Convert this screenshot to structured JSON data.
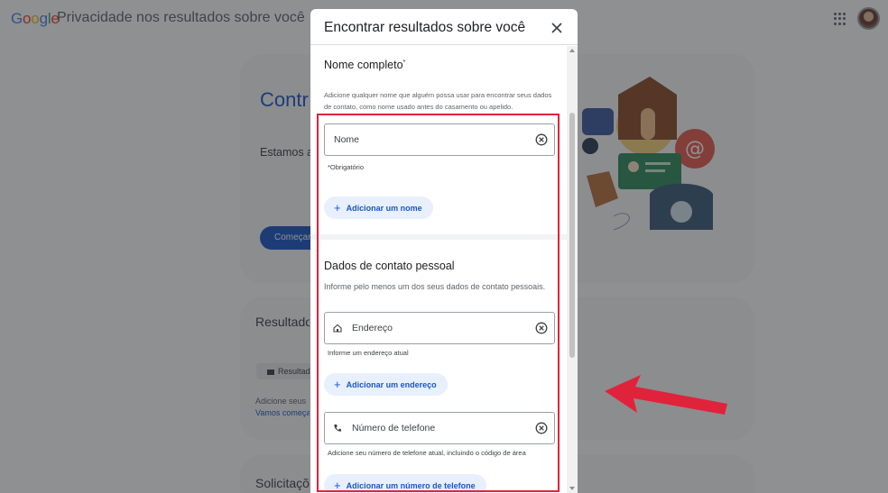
{
  "header": {
    "logo_text": "Google",
    "app_title": "Privacidade nos resultados sobre você"
  },
  "background": {
    "hero_title": "Contr privac",
    "hero_text": "Estamos ac suas inform no Google qualquer r desconfor",
    "hero_button": "Começar",
    "results_title": "Resultados",
    "results_chip": "Resultad",
    "results_text": "Adicione seus",
    "results_link": "Vamos começa",
    "requests_title": "Solicitações"
  },
  "modal": {
    "title": "Encontrar resultados sobre você",
    "name_section": {
      "title": "Nome completo",
      "required_mark": "*",
      "description": "Adicione qualquer nome que alguém possa usar para encontrar seus dados de contato, como nome usado antes do casamento ou apelido.",
      "field_placeholder": "Nome",
      "helper": "*Obrigatório",
      "add_label": "Adicionar um nome"
    },
    "contact_section": {
      "title": "Dados de contato pessoal",
      "description": "Informe pelo menos um dos seus dados de contato pessoais.",
      "address_placeholder": "Endereço",
      "address_helper": "Informe um endereço atual",
      "add_address_label": "Adicionar um endereço",
      "phone_placeholder": "Número de telefone",
      "phone_helper": "Adicione seu número de telefone atual, incluindo o código de área",
      "add_phone_label": "Adicionar um número de telefone"
    }
  },
  "icons": {
    "close": "close-icon",
    "clear": "clear-icon",
    "home": "home-icon",
    "phone": "phone-icon",
    "plus": "+",
    "apps": "apps-grid-icon"
  },
  "colors": {
    "accent": "#1a57c9",
    "highlight": "#e0233b",
    "chip_bg": "#e8f0fe"
  }
}
